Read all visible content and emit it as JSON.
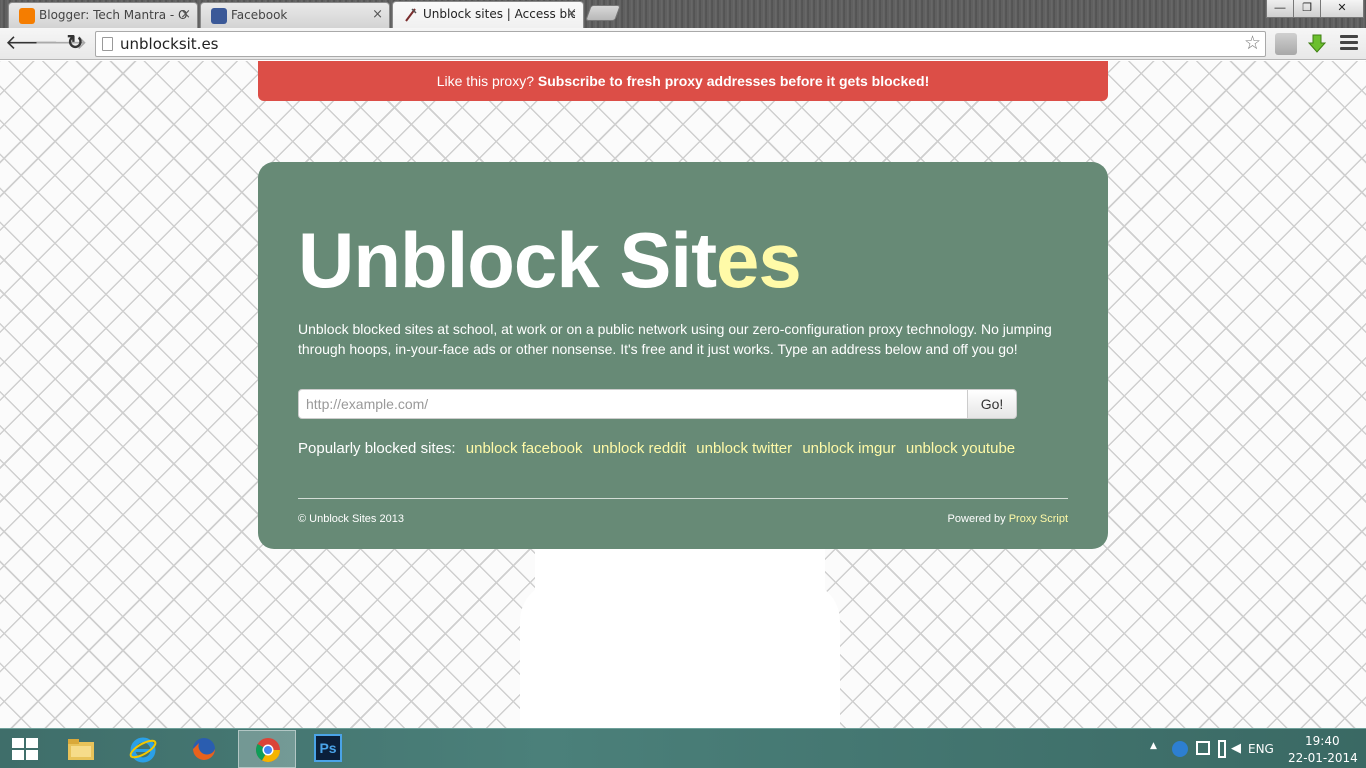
{
  "browser": {
    "tabs": [
      {
        "label": "Blogger: Tech Mantra - O",
        "favicon": "blogger-icon",
        "color": "#f57d00"
      },
      {
        "label": "Facebook",
        "favicon": "facebook-icon",
        "color": "#3b5998"
      },
      {
        "label": "Unblock sites | Access blo",
        "favicon": "proxy-icon",
        "color": "#555555"
      }
    ],
    "tab_close_glyph": "×",
    "window_controls": {
      "minimize": "—",
      "restore": "❐",
      "close": "✕"
    },
    "back_glyph": "🡐",
    "forward_glyph": "🡒",
    "reload_glyph": "↻",
    "address": "unblocksit.es",
    "star_glyph": "☆"
  },
  "banner": {
    "lead": "Like this proxy? ",
    "cta": "Subscribe to fresh proxy addresses before it gets blocked!",
    "color": "#dc4e47"
  },
  "main": {
    "title_main": "Unblock Sit",
    "title_accent": "es",
    "description": "Unblock blocked sites at school, at work or on a public network using our zero-configuration proxy technology. No jumping through hoops, in-your-face ads or other nonsense. It's free and it just works. Type an address below and off you go!",
    "url_placeholder": "http://example.com/",
    "go_label": "Go!",
    "popular_label": "Popularly blocked sites:",
    "popular_links": [
      "unblock facebook",
      "unblock reddit",
      "unblock twitter",
      "unblock imgur",
      "unblock youtube"
    ],
    "panel_color": "#678a76",
    "accent_color": "#fffaa8"
  },
  "footer": {
    "copyright": "© Unblock Sites 2013",
    "powered_prefix": "Powered by ",
    "powered_link": "Proxy Script"
  },
  "taskbar": {
    "apps": [
      "file-explorer-icon",
      "internet-explorer-icon",
      "firefox-icon",
      "chrome-icon",
      "photoshop-icon"
    ],
    "photoshop_label": "Ps",
    "language": "ENG",
    "time": "19:40",
    "date": "22-01-2014"
  }
}
